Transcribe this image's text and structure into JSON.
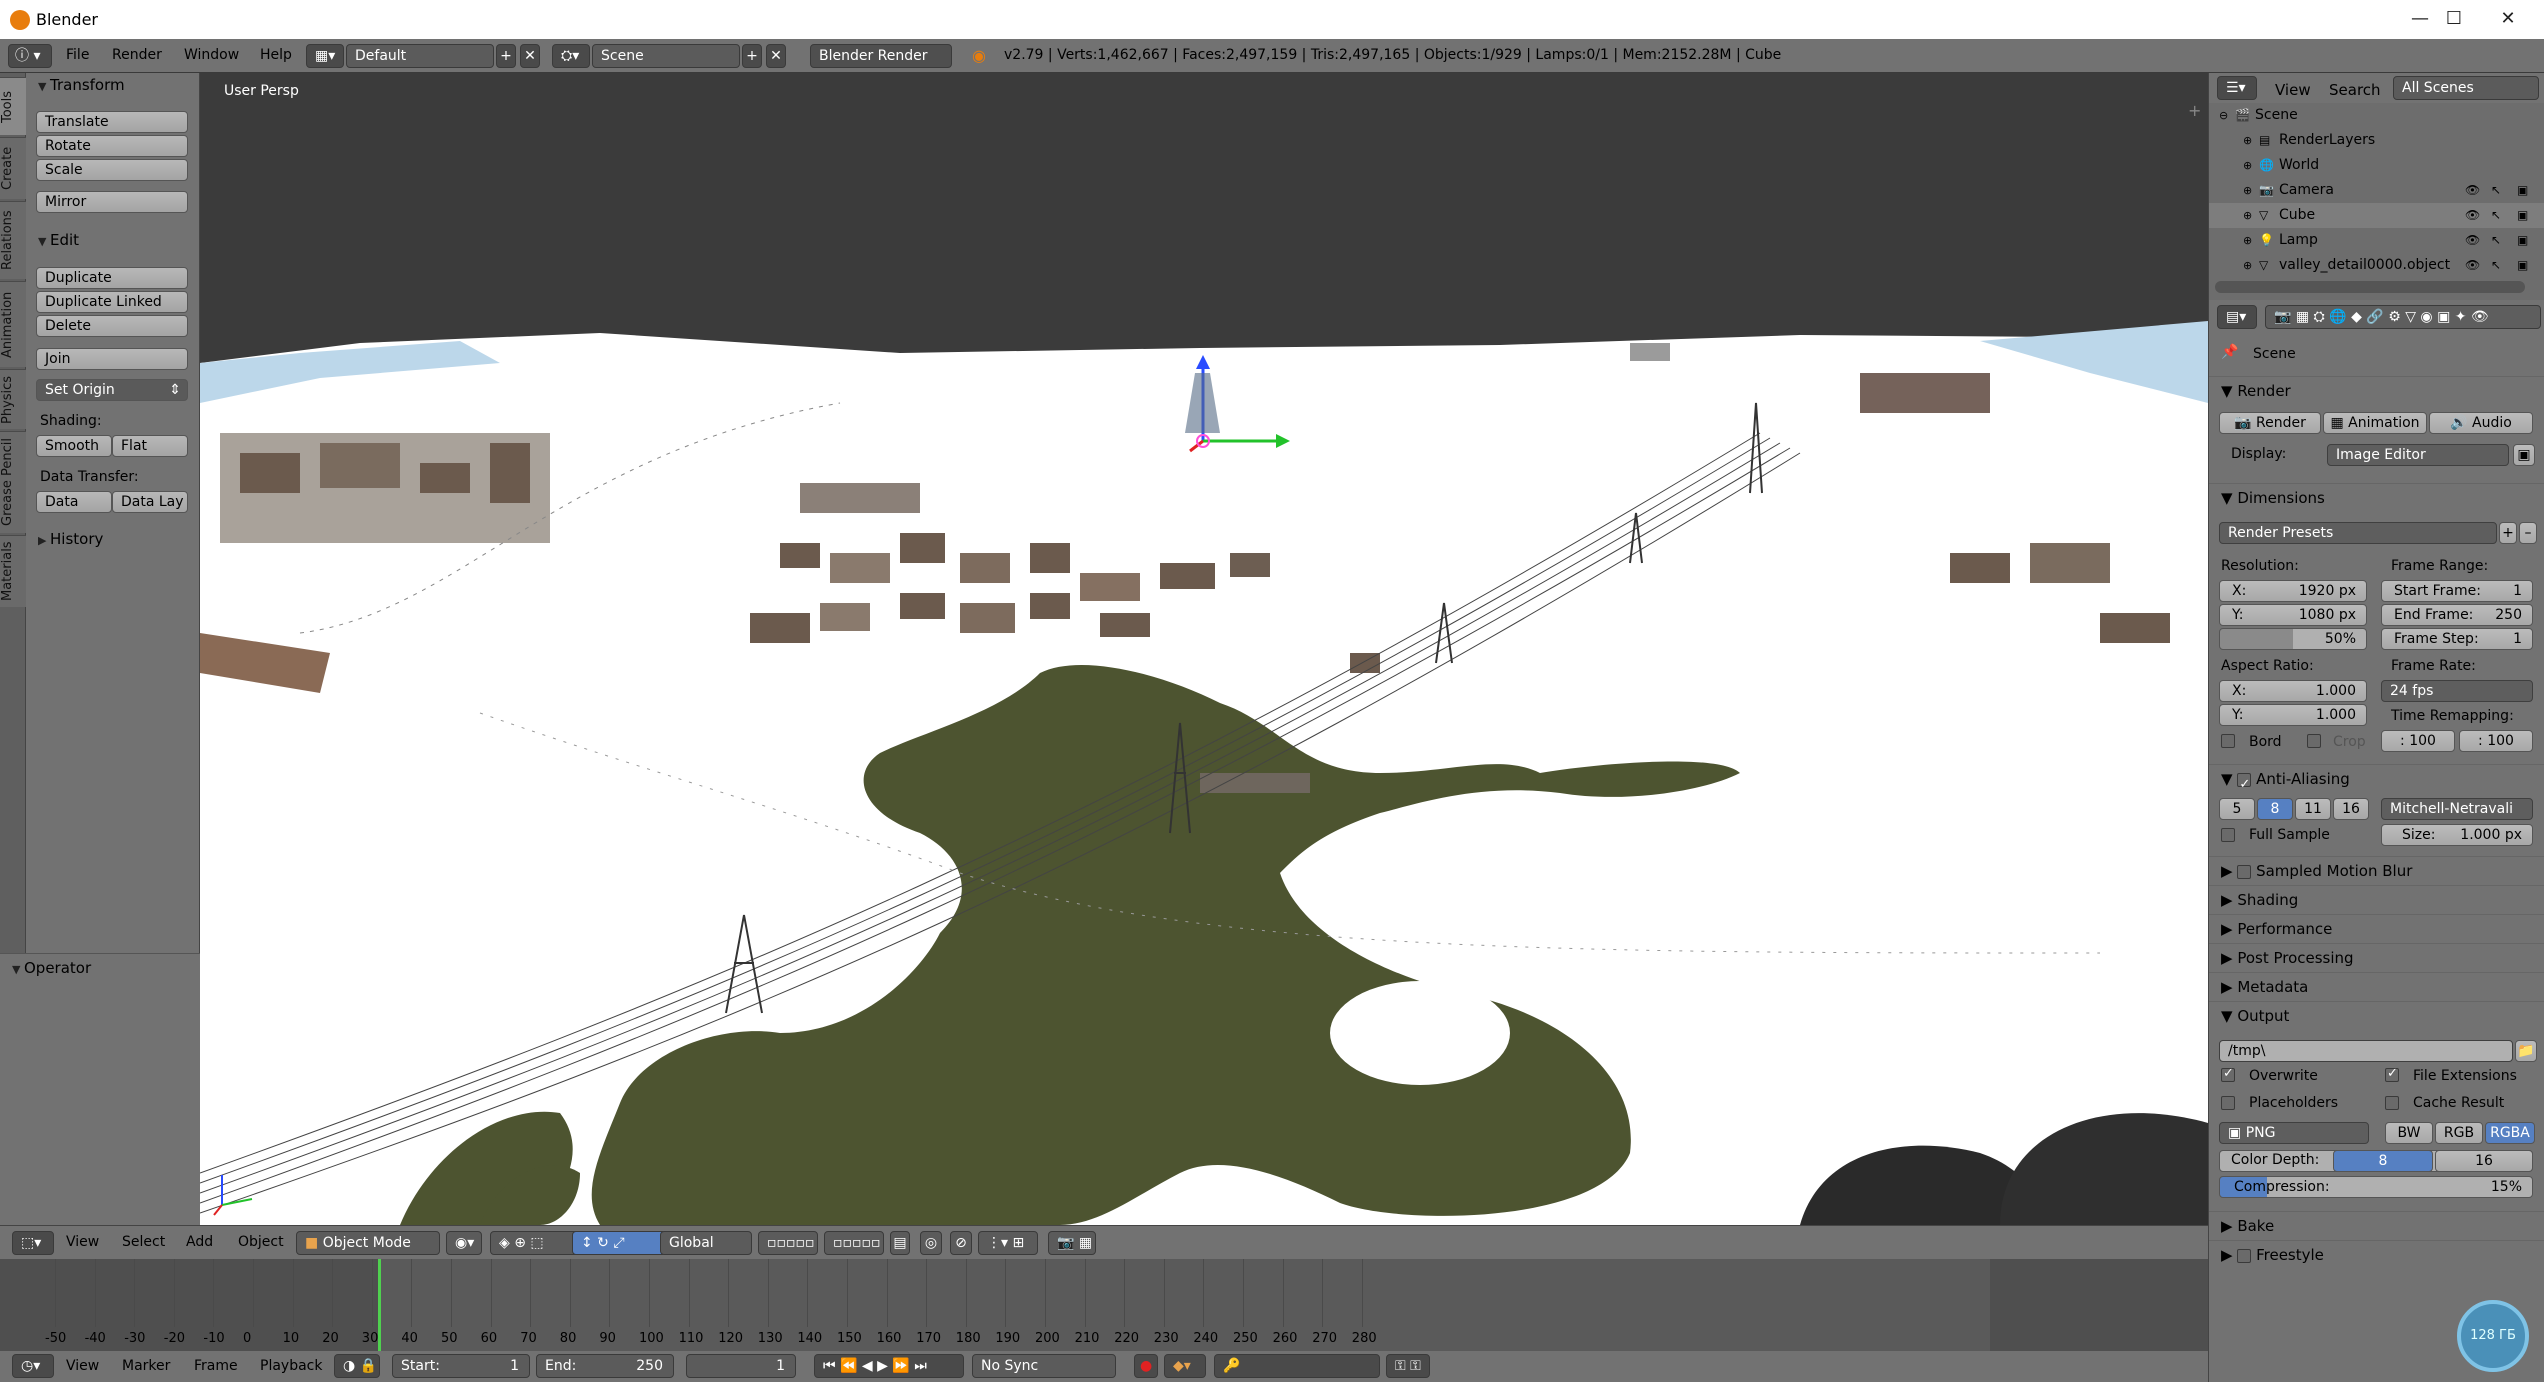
{
  "window": {
    "title": "Blender",
    "controls": [
      "—",
      "☐",
      "✕"
    ]
  },
  "menubar": {
    "items": [
      "File",
      "Render",
      "Window",
      "Help"
    ],
    "layout": "Default",
    "scene": "Scene",
    "engine": "Blender Render",
    "stats": "v2.79 | Verts:1,462,667 | Faces:2,497,159 | Tris:2,497,165 | Objects:1/929 | Lamps:0/1 | Mem:2152.28M | Cube"
  },
  "lefttabs": [
    "Tools",
    "Create",
    "Relations",
    "Animation",
    "Physics",
    "Grease Pencil",
    "Materials"
  ],
  "toolshelf": {
    "transform": {
      "header": "Transform",
      "buttons": [
        "Translate",
        "Rotate",
        "Scale",
        "Mirror"
      ]
    },
    "edit": {
      "header": "Edit",
      "buttons": [
        "Duplicate",
        "Duplicate Linked",
        "Delete",
        "Join"
      ],
      "set_origin": "Set Origin",
      "shading_label": "Shading:",
      "smooth": "Smooth",
      "flat": "Flat",
      "transfer_label": "Data Transfer:",
      "data": "Data",
      "data_lay": "Data Lay"
    },
    "history": "History",
    "operator": "Operator"
  },
  "viewport": {
    "label": "User Persp"
  },
  "viewport_header": {
    "menus": [
      "View",
      "Select",
      "Add",
      "Object"
    ],
    "mode": "Object Mode",
    "orientation": "Global"
  },
  "timeline": {
    "ticks": [
      "-50",
      "-40",
      "-30",
      "-20",
      "-10",
      "0",
      "10",
      "20",
      "30",
      "40",
      "50",
      "60",
      "70",
      "80",
      "90",
      "100",
      "110",
      "120",
      "130",
      "140",
      "150",
      "160",
      "170",
      "180",
      "190",
      "200",
      "210",
      "220",
      "230",
      "240",
      "250",
      "260",
      "270",
      "280"
    ],
    "current_frame": "0"
  },
  "timeline_header": {
    "menus": [
      "View",
      "Marker",
      "Frame",
      "Playback"
    ],
    "start": "Start:",
    "start_val": "1",
    "end": "End:",
    "end_val": "250",
    "frame": "1",
    "sync": "No Sync"
  },
  "outliner": {
    "menus": [
      "View",
      "Search"
    ],
    "filter": "All Scenes",
    "rows": [
      {
        "label": "Scene",
        "indent": 0
      },
      {
        "label": "RenderLayers",
        "indent": 1
      },
      {
        "label": "World",
        "indent": 1
      },
      {
        "label": "Camera",
        "indent": 1
      },
      {
        "label": "Cube",
        "indent": 1
      },
      {
        "label": "Lamp",
        "indent": 1
      },
      {
        "label": "valley_detail0000.object",
        "indent": 1
      }
    ]
  },
  "props": {
    "context": "Scene",
    "render": {
      "header": "Render",
      "tabs": [
        "Render",
        "Animation",
        "Audio"
      ],
      "display_label": "Display:",
      "display": "Image Editor"
    },
    "dimensions": {
      "header": "Dimensions",
      "presets": "Render Presets",
      "resolution": "Resolution:",
      "res_x": "X:",
      "res_x_val": "1920 px",
      "res_y": "Y:",
      "res_y_val": "1080 px",
      "percent": "50%",
      "frame_range": "Frame Range:",
      "start_frame": "Start Frame:",
      "start_val": "1",
      "end_frame": "End Frame:",
      "end_val": "250",
      "frame_step": "Frame Step:",
      "step_val": "1",
      "aspect": "Aspect Ratio:",
      "asp_x": "X:",
      "asp_x_val": "1.000",
      "asp_y": "Y:",
      "asp_y_val": "1.000",
      "frame_rate": "Frame Rate:",
      "fps": "24 fps",
      "remap": "Time Remapping:",
      "remap_old": ": 100",
      "remap_new": ": 100",
      "bord": "Bord",
      "crop": "Crop"
    },
    "aa": {
      "header": "Anti-Aliasing",
      "samples": [
        "5",
        "8",
        "11",
        "16"
      ],
      "active": "8",
      "filter": "Mitchell-Netravali",
      "full_sample": "Full Sample",
      "size": "Size:",
      "size_val": "1.000 px"
    },
    "collapsed": [
      "Sampled Motion Blur",
      "Shading",
      "Performance",
      "Post Processing",
      "Metadata"
    ],
    "output": {
      "header": "Output",
      "path": "/tmp\\",
      "overwrite": "Overwrite",
      "file_ext": "File Extensions",
      "placeholders": "Placeholders",
      "cache": "Cache Result",
      "format": "PNG",
      "bw": "BW",
      "rgb": "RGB",
      "rgba": "RGBA",
      "color_depth": "Color Depth:",
      "cd8": "8",
      "cd16": "16",
      "compression": "Compression:",
      "comp_val": "15%"
    },
    "bake": "Bake",
    "freestyle": "Freestyle"
  },
  "overlay_badge": "128 ГБ"
}
